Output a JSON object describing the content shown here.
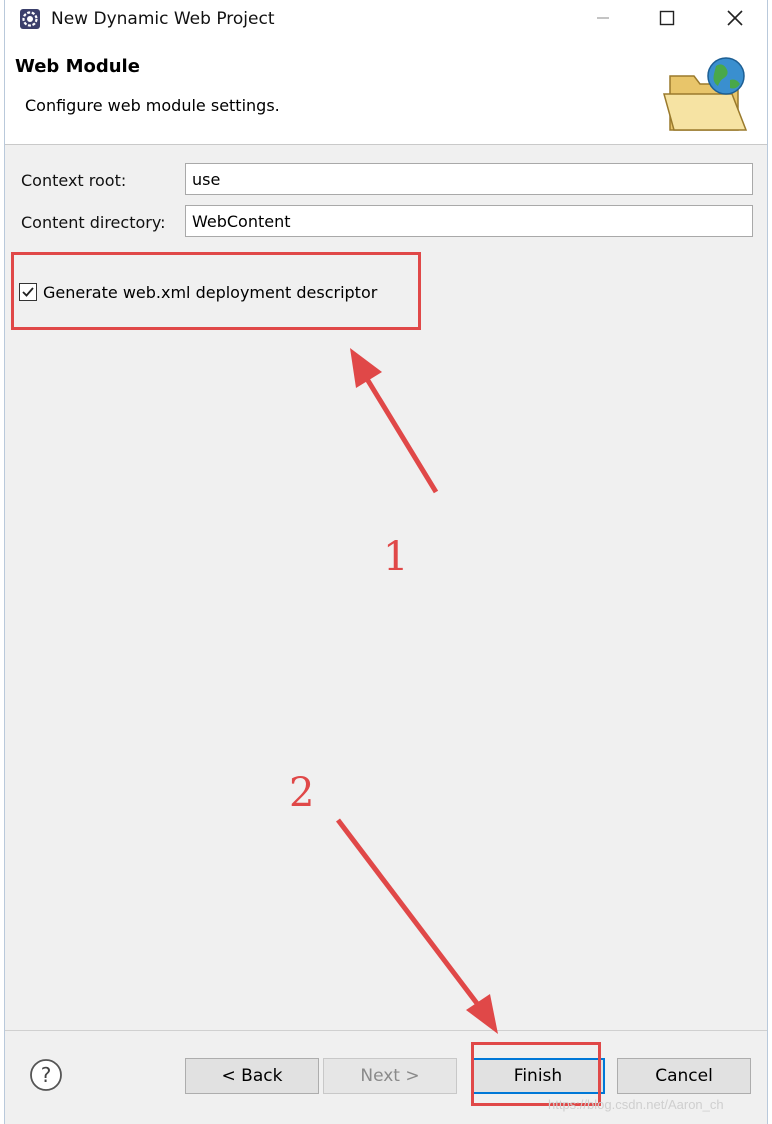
{
  "window": {
    "title": "New Dynamic Web Project",
    "icon": "eclipse-gear-icon",
    "controls": [
      "minimize-icon",
      "maximize-icon",
      "close-icon"
    ]
  },
  "header": {
    "title": "Web Module",
    "description": "Configure web module settings.",
    "image": "folder-globe-icon"
  },
  "form": {
    "context_root_label": "Context root:",
    "context_root_value": "use",
    "content_dir_label": "Content directory:",
    "content_dir_value": "WebContent",
    "generate_label": "Generate web.xml deployment descriptor",
    "generate_checked": true
  },
  "annotations": {
    "label_1": "1",
    "label_2": "2",
    "color": "#e04848"
  },
  "buttons": {
    "help_icon": "help-icon",
    "back": "< Back",
    "next": "Next >",
    "finish": "Finish",
    "cancel": "Cancel"
  },
  "watermark": "https://blog.csdn.net/Aaron_ch"
}
